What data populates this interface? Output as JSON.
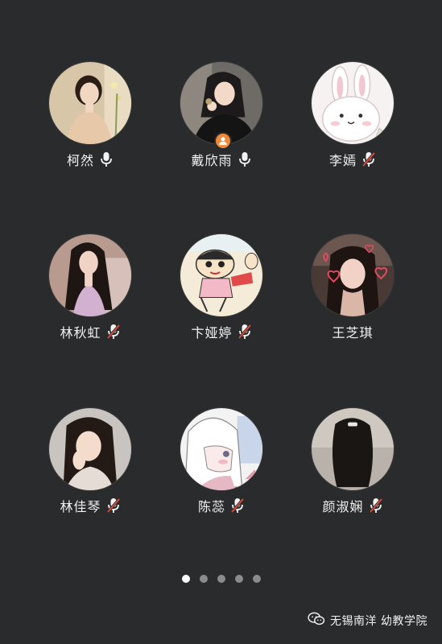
{
  "participants": [
    {
      "name": "柯然",
      "mic": "on",
      "avatar": "photo-warm-girl-icon",
      "host": false
    },
    {
      "name": "戴欣雨",
      "mic": "on",
      "avatar": "photo-dark-girl-icon",
      "host": true
    },
    {
      "name": "李嫣",
      "mic": "muted",
      "avatar": "cartoon-bunny-icon",
      "host": false
    },
    {
      "name": "林秋虹",
      "mic": "muted",
      "avatar": "photo-long-hair-girl-icon",
      "host": false
    },
    {
      "name": "卞娅婷",
      "mic": "muted",
      "avatar": "crayon-shinchan-icon",
      "host": false
    },
    {
      "name": "王芝琪",
      "mic": "none",
      "avatar": "photo-heart-filter-girl-icon",
      "host": false
    },
    {
      "name": "林佳琴",
      "mic": "muted",
      "avatar": "photo-hand-on-face-girl-icon",
      "host": false
    },
    {
      "name": "陈蕊",
      "mic": "muted",
      "avatar": "anime-girl-icon",
      "host": false
    },
    {
      "name": "颜淑娴",
      "mic": "muted",
      "avatar": "photo-back-view-girl-icon",
      "host": false
    }
  ],
  "pagination": {
    "total": 5,
    "active": 0
  },
  "watermark": {
    "text": "无锡南洋 幼教学院",
    "icon": "wechat-icon"
  },
  "colors": {
    "background": "#2a2b2c",
    "host_badge": "#f08a3a",
    "muted_slash": "#e04a3a"
  }
}
